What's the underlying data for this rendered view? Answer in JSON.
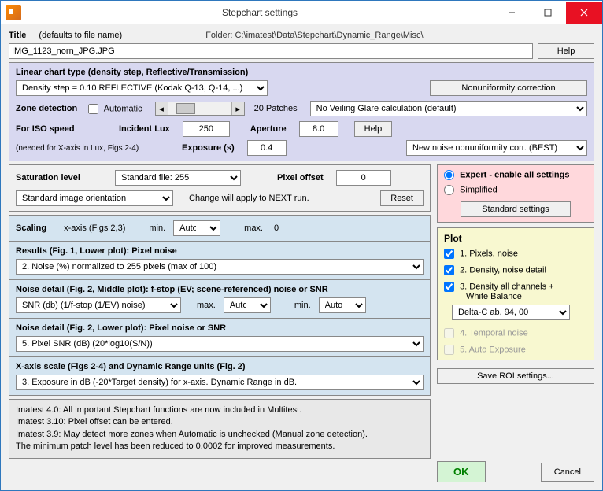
{
  "window": {
    "title": "Stepchart settings"
  },
  "header": {
    "title_label": "Title",
    "title_hint": "(defaults to file name)",
    "folder_label": "Folder:",
    "folder_value": "C:\\imatest\\Data\\Stepchart\\Dynamic_Range\\Misc\\",
    "filename": "IMG_1123_norn_JPG.JPG",
    "help": "Help"
  },
  "linear": {
    "heading": "Linear chart type (density step, Reflective/Transmission)",
    "density_sel": "Density step = 0.10  REFLECTIVE     (Kodak Q-13, Q-14, ...)",
    "nonuniformity_btn": "Nonuniformity correction",
    "zone_label": "Zone detection",
    "automatic": "Automatic",
    "patches": "20 Patches",
    "veiling_sel": "No Veiling Glare calculation  (default)",
    "iso_label": "For ISO speed",
    "iso_note": "(needed for X-axis in Lux, Figs 2-4)",
    "incident_lux_label": "Incident Lux",
    "incident_lux_val": "250",
    "aperture_label": "Aperture",
    "aperture_val": "8.0",
    "help": "Help",
    "exposure_label": "Exposure (s)",
    "exposure_val": "0.4",
    "noise_corr_sel": "New noise nonuniformity corr. (BEST)"
  },
  "sat": {
    "label": "Saturation level",
    "file_sel": "Standard file:  255",
    "pixel_offset_label": "Pixel offset",
    "pixel_offset_val": "0",
    "orient_sel": "Standard image orientation",
    "change_note": "Change will apply to NEXT run.",
    "reset": "Reset"
  },
  "mode": {
    "expert": "Expert - enable all settings",
    "simplified": "Simplified",
    "standard_btn": "Standard settings"
  },
  "scaling": {
    "label": "Scaling",
    "xaxis": "x-axis (Figs 2,3)",
    "min_label": "min.",
    "min_sel": "Auto",
    "max_label": "max.",
    "max_val": "0",
    "results_heading": "Results (Fig. 1, Lower plot):   Pixel noise",
    "results_sel": "2. Noise (%) normalized to 255 pixels (max of 100)",
    "nd_mid_heading": "Noise detail (Fig. 2, Middle plot):   f-stop (EV; scene-referenced) noise or SNR",
    "nd_mid_sel": "SNR (db) (1/f-stop (1/EV) noise)",
    "nd_mid_max_sel": "Auto",
    "nd_mid_min_sel": "Auto",
    "nd_low_heading": "Noise detail (Fig. 2, Lower plot):   Pixel noise or SNR",
    "nd_low_sel": "5. Pixel SNR (dB)   (20*log10(S/N))",
    "xscale_heading": "X-axis scale (Figs 2-4) and Dynamic Range units (Fig. 2)",
    "xscale_sel": "3. Exposure in dB (-20*Target density) for x-axis.   Dynamic Range in dB."
  },
  "plot": {
    "heading": "Plot",
    "p1": "1. Pixels, noise",
    "p2": "2. Density, noise detail",
    "p3a": "3. Density all channels +",
    "p3b": "White Balance",
    "p3_sel": "Delta-C ab, 94, 00",
    "p4": "4. Temporal noise",
    "p5": "5. Auto Exposure"
  },
  "notes": {
    "l1": "Imatest 4.0:  All important Stepchart functions are now included in Multitest.",
    "l2": "Imatest 3.10:  Pixel offset can be entered.",
    "l3": "Imatest 3.9:   May detect more zones when Automatic is unchecked (Manual zone detection).",
    "l4": "The minimum patch level has been reduced to 0.0002 for improved measurements."
  },
  "footer": {
    "save_roi": "Save ROI settings...",
    "ok": "OK",
    "cancel": "Cancel"
  }
}
